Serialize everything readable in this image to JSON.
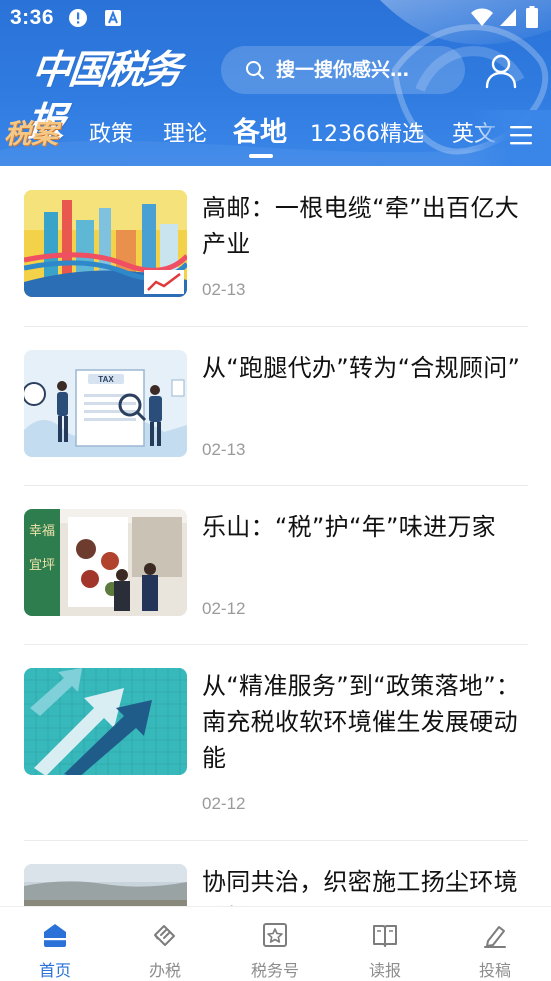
{
  "status_bar": {
    "time": "3:36",
    "icons": [
      "alert-icon",
      "app-notification-icon",
      "wifi-icon",
      "signal-icon",
      "battery-icon"
    ]
  },
  "header": {
    "logo_text": "中国税务报",
    "search_placeholder": "搜一搜你感兴…",
    "brand_color": "#2f7be0"
  },
  "tabs": [
    {
      "label": "税案",
      "active": false
    },
    {
      "label": "政策",
      "active": false
    },
    {
      "label": "理论",
      "active": false
    },
    {
      "label": "各地",
      "active": true
    },
    {
      "label": "12366精选",
      "active": false
    },
    {
      "label": "英文",
      "active": false
    }
  ],
  "articles": [
    {
      "title": "高邮：一根电缆“牵”出百亿大产业",
      "date": "02-13"
    },
    {
      "title": "从“跑腿代办”转为“合规顾问”",
      "date": "02-13"
    },
    {
      "title": "乐山：“税”护“年”味进万家",
      "date": "02-12"
    },
    {
      "title": "从“精准服务”到“政策落地”：南充税收软环境催生发展硬动能",
      "date": "02-12"
    },
    {
      "title": "协同共治，织密施工扬尘环境防护网",
      "date": ""
    }
  ],
  "thumb_labels": {
    "tax_board": "TAX",
    "banner": "幸福宜坪"
  },
  "bottom_nav": [
    {
      "label": "首页",
      "icon": "home-icon",
      "active": true
    },
    {
      "label": "办税",
      "icon": "tax-service-icon",
      "active": false
    },
    {
      "label": "税务号",
      "icon": "star-badge-icon",
      "active": false
    },
    {
      "label": "读报",
      "icon": "book-icon",
      "active": false
    },
    {
      "label": "投稿",
      "icon": "pen-icon",
      "active": false
    }
  ],
  "colors": {
    "accent": "#2a72d8",
    "tab_special": "#f7c884",
    "date_gray": "#9a9a9a",
    "nav_gray": "#8d8d8d"
  }
}
